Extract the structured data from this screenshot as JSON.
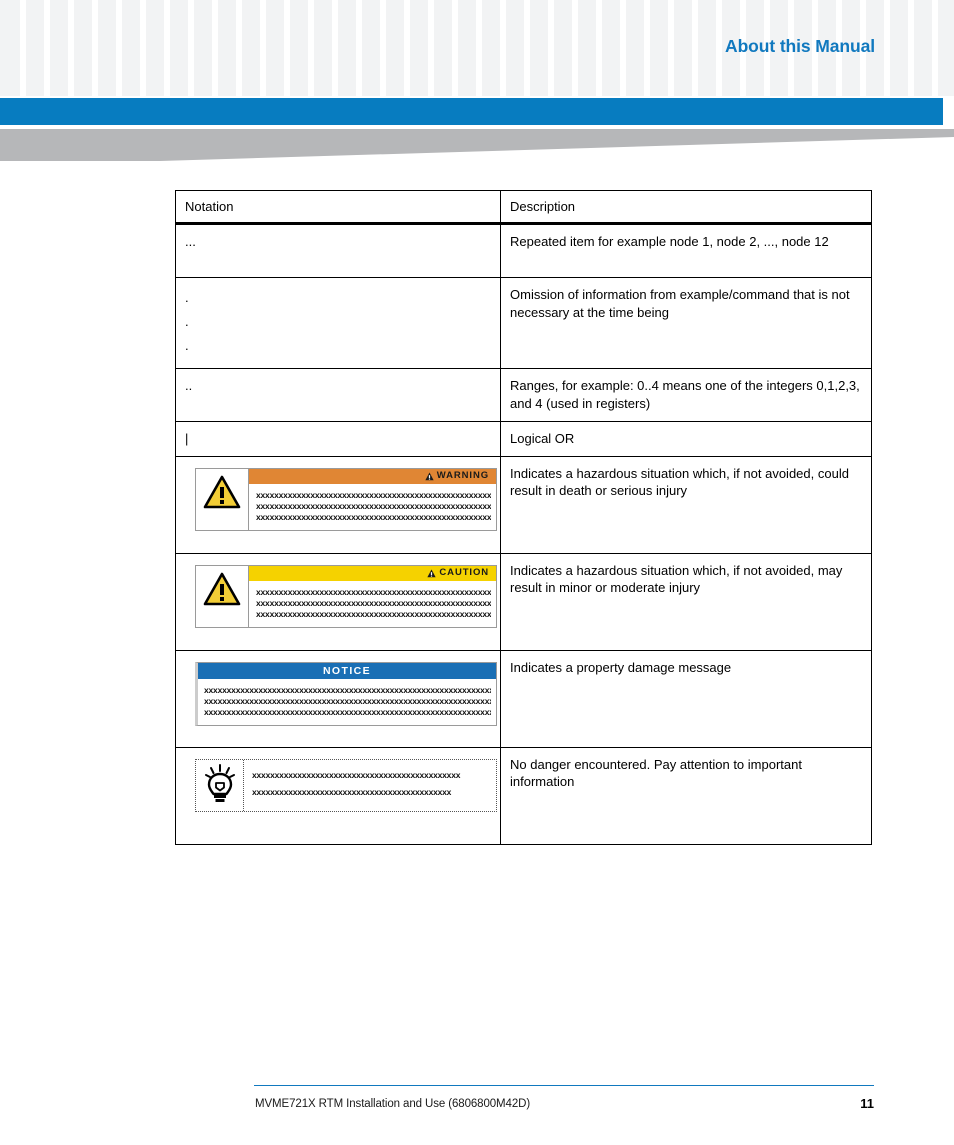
{
  "header": {
    "title": "About this Manual",
    "accent_blue": "#077cc0",
    "title_blue": "#1179bf",
    "pattern_square_color": "#f2f3f4",
    "swoosh_gray": "#b6b7b9"
  },
  "table": {
    "columns": [
      "Notation",
      "Description"
    ],
    "rows": [
      {
        "id": "ellipsis",
        "notation_text": "...",
        "notation_kind": "text",
        "description": "Repeated item for example node 1, node 2, ..., node 12"
      },
      {
        "id": "vertical-dots",
        "notation_kind": "vdots",
        "notation_lines": [
          ".",
          ".",
          "."
        ],
        "description": "Omission of information from example/command that is not necessary at the time being"
      },
      {
        "id": "range",
        "notation_text": "..",
        "notation_kind": "text",
        "description": "Ranges, for example: 0..4 means one of the integers 0,1,2,3, and 4 (used in registers)"
      },
      {
        "id": "logical-or",
        "notation_text": "|",
        "notation_kind": "text",
        "description": "Logical OR"
      },
      {
        "id": "warning",
        "notation_kind": "admonition",
        "admonition": {
          "label": "WARNING",
          "bar_color": "#e08634",
          "label_color": "#1a1a1a",
          "icon": "warning-triangle-icon",
          "body_lines": [
            "xxxxxxxxxxxxxxxxxxxxxxxxxxxxxxxxxxxxxxxxxxxxxxxxxxxxxxxxxxxx",
            "xxxxxxxxxxxxxxxxxxxxxxxxxxxxxxxxxxxxxxxxxxxxxxxxxxxxxxxxxxxx",
            "xxxxxxxxxxxxxxxxxxxxxxxxxxxxxxxxxxxxxxxxxxxxxxxxxxxxxxxxxxxx"
          ]
        },
        "description": "Indicates a hazardous situation which, if not avoided, could result in death or serious injury"
      },
      {
        "id": "caution",
        "notation_kind": "admonition",
        "admonition": {
          "label": "CAUTION",
          "bar_color": "#f5d200",
          "label_color": "#1a1a1a",
          "icon": "warning-triangle-icon",
          "body_lines": [
            "xxxxxxxxxxxxxxxxxxxxxxxxxxxxxxxxxxxxxxxxxxxxxxxxxxxxxxxxxxxx",
            "xxxxxxxxxxxxxxxxxxxxxxxxxxxxxxxxxxxxxxxxxxxxxxxxxxxxxxxxxxxx",
            "xxxxxxxxxxxxxxxxxxxxxxxxxxxxxxxxxxxxxxxxxxxxxxxxxxxxxxxxxxxx"
          ]
        },
        "description": "Indicates a hazardous situation which, if not avoided, may result in minor or moderate injury"
      },
      {
        "id": "notice",
        "notation_kind": "notice",
        "admonition": {
          "label": "NOTICE",
          "bar_color": "#1a6fb5",
          "label_color": "#ffffff",
          "body_lines": [
            "xxxxxxxxxxxxxxxxxxxxxxxxxxxxxxxxxxxxxxxxxxxxxxxxxxxxxxxxxxxxxxxxxx",
            "xxxxxxxxxxxxxxxxxxxxxxxxxxxxxxxxxxxxxxxxxxxxxxxxxxxxxxxxxxxxxxxxxx",
            "xxxxxxxxxxxxxxxxxxxxxxxxxxxxxxxxxxxxxxxxxxxxxxxxxxxxxxxxxxxxxxxxxx"
          ]
        },
        "description": "Indicates a property damage message"
      },
      {
        "id": "tip",
        "notation_kind": "tip",
        "admonition": {
          "icon": "lightbulb-icon",
          "body_lines": [
            "xxxxxxxxxxxxxxxxxxxxxxxxxxxxxxxxxxxxxxxxxxxxxx",
            "xxxxxxxxxxxxxxxxxxxxxxxxxxxxxxxxxxxxxxxxxxxx"
          ]
        },
        "description": "No danger encountered. Pay attention to important information"
      }
    ]
  },
  "footer": {
    "document_title": "MVME721X RTM Installation and Use (6806800M42D)",
    "page_number": "11",
    "rule_color": "#1179bf"
  }
}
